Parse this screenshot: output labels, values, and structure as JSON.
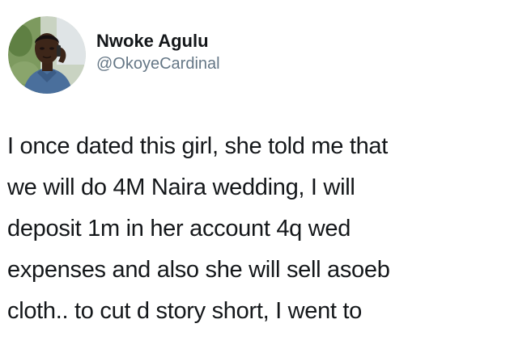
{
  "author": {
    "display_name": "Nwoke Agulu",
    "handle": "@OkoyeCardinal"
  },
  "tweet": {
    "lines": [
      "I once dated this girl, she told me that",
      "we will do 4M Naira wedding, I will",
      "deposit 1m in her account 4q wed",
      "expenses and also she will sell asoeb",
      "cloth.. to cut d story short, I went to"
    ]
  },
  "colors": {
    "name": "#14171a",
    "handle": "#657786",
    "text": "#14171a",
    "background": "#ffffff"
  },
  "icons": {
    "avatar": "profile-photo"
  }
}
